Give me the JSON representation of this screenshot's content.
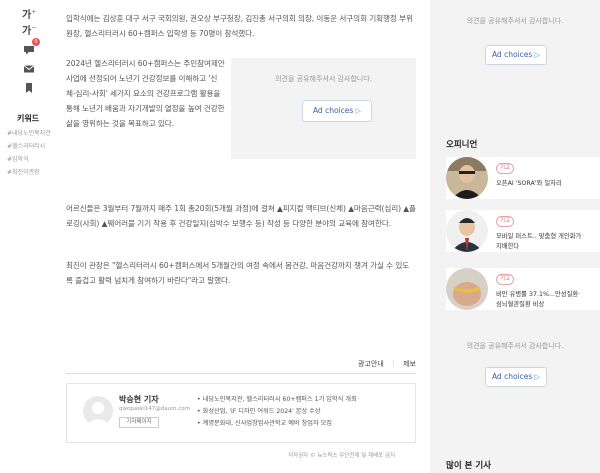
{
  "toolbar": {
    "font_larger": "가",
    "font_smaller": "가",
    "comment_count": "0",
    "keywords_title": "키워드",
    "keywords": [
      "#내당노인복지관",
      "#헬스리터러시",
      "#입학식",
      "#최진이관장"
    ]
  },
  "article": {
    "p1": "입학식에는 김상훈 대구 서구 국회의원, 권오상 부구청장, 김진총 서구의회 의장, 이동운 서구의회 기획행정 부위원장, 헬스리터러시 60+캠퍼스 입학생 등 70명이 참석했다.",
    "p2": "2024년 헬스리터러시 60+캠퍼스는 주민참여제안 사업에 선정되어 노년기 건강정보를 이해하고 '신체-심리-사회' 세가지 요소의 건강프로그램 활용을 통해 노년기 배움과 자기개발의 열정을 높여 건강한 삶을 영위하는 것을 목표하고 있다.",
    "p3": "어르신들은 3월부터 7월까지 매주 1회 총20회(5개월 과정)에 걸쳐 ▲피지컬 액티브(신체) ▲마음근력(심리) ▲플로깅(사회) ▲웨어러블 기기 착용 후 건강일지(심박수 보행수 등) 작성 등 다양한 분야의 교육에 참여한다.",
    "p4": "최진이 관장은 \"헬스리터러시 60+캠퍼스에서 5개월간의 여정 속에서 몸건강, 마음건강까지 챙겨 가실 수 있도록 즐겁고 활력 넘치게 참여하기 바란다\"라고 말했다."
  },
  "ads": {
    "caption": "의견을 공유해주셔서 감사합니다.",
    "choices_label": "Ad choices"
  },
  "footer": {
    "guide": "광고안내",
    "report": "제보",
    "copyright": "저작권자 © 뉴스픽스 무단전재 및 재배포 금지"
  },
  "reporter": {
    "name": "박승현 기자",
    "email": "qwopaskl147@daum.com",
    "page_button": "기자페이지",
    "related": [
      "내당노인복지관, 헬스리터러시 60+캠퍼스 1기 입학식 개최",
      "화성산업, 'iF 디자인 어워드 2024' 본상 수상",
      "계명문화대, 신사업창업사관학교 예비 창업자 모집"
    ]
  },
  "sidebar": {
    "opinion_title": "오피니언",
    "opinions": [
      {
        "tag": "기고",
        "text": "오픈AI 'SORA'와 일자리"
      },
      {
        "tag": "기고",
        "text": "모바일 퍼스트.. 맞춤형 개인화가 지배한다"
      },
      {
        "tag": "기고",
        "text": "비만 유병률 37.1%...만성질환·심뇌혈관질환 비상"
      }
    ],
    "popular_title": "많이 본 기사"
  },
  "colors": {
    "accent": "#e8515b",
    "ad_link": "#3a5fa8",
    "sidebar_bg": "#f3f3f3"
  }
}
